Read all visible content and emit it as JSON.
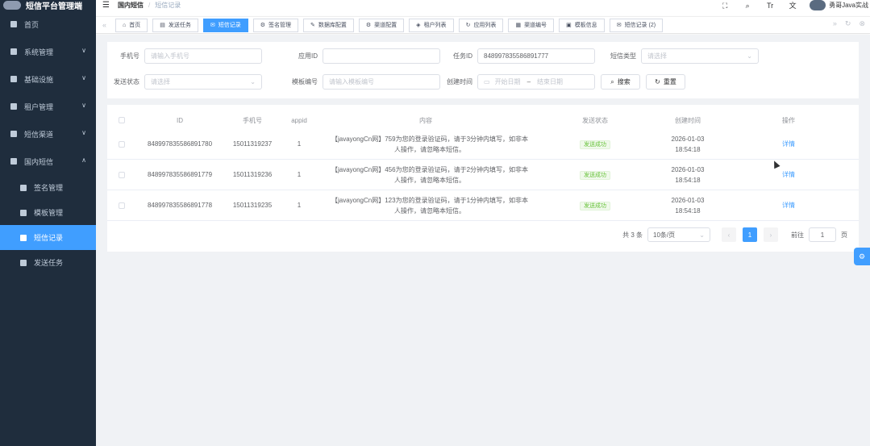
{
  "app": {
    "title": "短信平台管理端"
  },
  "sidebar": {
    "items": [
      {
        "label": "首页",
        "icon": "home-icon"
      },
      {
        "label": "系统管理",
        "icon": "gear-icon",
        "arrow": "∨"
      },
      {
        "label": "基础设施",
        "icon": "monitor-icon",
        "arrow": "∨"
      },
      {
        "label": "租户管理",
        "icon": "binoculars-icon",
        "arrow": "∨"
      },
      {
        "label": "短信渠道",
        "icon": "card-icon",
        "arrow": "∨"
      },
      {
        "label": "国内短信",
        "icon": "card-icon",
        "arrow": "∧"
      }
    ],
    "sub_items": [
      {
        "label": "签名管理",
        "icon": "gear-icon"
      },
      {
        "label": "模板管理",
        "icon": "image-icon"
      },
      {
        "label": "短信记录",
        "icon": "mail-icon"
      },
      {
        "label": "发送任务",
        "icon": "folder-icon"
      }
    ]
  },
  "navbar": {
    "breadcrumb": [
      "国内短信",
      "短信记录"
    ],
    "user": "勇哥Java实战",
    "icons": [
      "fullscreen-icon",
      "search-icon",
      "font-size-icon",
      "translate-icon"
    ],
    "icon_glyphs": [
      "⛶",
      "⌕",
      "Tr",
      "文"
    ]
  },
  "tags": [
    {
      "label": "首页",
      "icon": "home-icon",
      "glyph": "⌂"
    },
    {
      "label": "发送任务",
      "icon": "folder-icon",
      "glyph": "▤"
    },
    {
      "label": "短信记录",
      "icon": "mail-icon",
      "glyph": "✉",
      "active": true
    },
    {
      "label": "签名管理",
      "icon": "gear-icon",
      "glyph": "⚙"
    },
    {
      "label": "数据库配置",
      "icon": "edit-icon",
      "glyph": "✎"
    },
    {
      "label": "渠道配置",
      "icon": "gear-icon",
      "glyph": "⚙"
    },
    {
      "label": "租户列表",
      "icon": "code-icon",
      "glyph": "◈"
    },
    {
      "label": "应用列表",
      "icon": "refresh-icon",
      "glyph": "↻"
    },
    {
      "label": "渠道编号",
      "icon": "grid-icon",
      "glyph": "▦"
    },
    {
      "label": "模板信息",
      "icon": "image-icon",
      "glyph": "▣"
    },
    {
      "label": "短信记录 (2)",
      "icon": "mail-icon",
      "glyph": "✉"
    }
  ],
  "tags_controls": {
    "left": "«",
    "right": "»",
    "refresh": "↻",
    "close": "⊗"
  },
  "search": {
    "phone_label": "手机号",
    "phone_placeholder": "请输入手机号",
    "app_label": "应用ID",
    "app_value": "",
    "task_label": "任务ID",
    "task_value": "848997835586891777",
    "sms_type_label": "短信类型",
    "sms_type_placeholder": "请选择",
    "send_status_label": "发送状态",
    "send_status_placeholder": "请选择",
    "template_label": "模板编号",
    "template_placeholder": "请输入模板编号",
    "created_label": "创建时间",
    "start_placeholder": "开始日期",
    "range_sep": "–",
    "end_placeholder": "结束日期",
    "search_btn": "搜索",
    "reset_btn": "重置"
  },
  "table": {
    "headers": [
      "ID",
      "手机号",
      "appid",
      "内容",
      "发送状态",
      "创建时间",
      "操作"
    ],
    "rows": [
      {
        "id": "848997835586891780",
        "phone": "15011319237",
        "appid": "1",
        "content1": "【javayongCn网】759为您的登录验证码，请于3分钟内填写，如非本",
        "content2": "人操作，请忽略本短信。",
        "status": "发送成功",
        "date": "2026-01-03",
        "time": "18:54:18",
        "action": "详情"
      },
      {
        "id": "848997835586891779",
        "phone": "15011319236",
        "appid": "1",
        "content1": "【javayongCn网】456为您的登录验证码，请于2分钟内填写，如非本",
        "content2": "人操作，请忽略本短信。",
        "status": "发送成功",
        "date": "2026-01-03",
        "time": "18:54:18",
        "action": "详情"
      },
      {
        "id": "848997835586891778",
        "phone": "15011319235",
        "appid": "1",
        "content1": "【javayongCn网】123为您的登录验证码，请于1分钟内填写，如非本",
        "content2": "人操作，请忽略本短信。",
        "status": "发送成功",
        "date": "2026-01-03",
        "time": "18:54:18",
        "action": "详情"
      }
    ]
  },
  "pagination": {
    "total": "共 3 条",
    "page_size": "10条/页",
    "current": "1",
    "goto_label": "前往",
    "goto_value": "1",
    "page_suffix": "页",
    "prev": "‹",
    "next": "›"
  },
  "colors": {
    "primary": "#409eff",
    "sidebar": "#1f2d3d",
    "success": "#67c23a"
  }
}
